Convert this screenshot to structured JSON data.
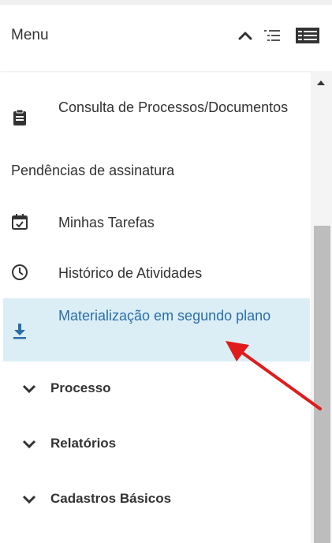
{
  "header": {
    "title": "Menu"
  },
  "menu": {
    "items": [
      {
        "label": "Consulta de Processos/Documentos",
        "icon": "clipboard-icon"
      },
      {
        "label": "Pendências de assinatura"
      },
      {
        "label": "Minhas Tarefas",
        "icon": "calendar-check-icon"
      },
      {
        "label": "Histórico de Atividades",
        "icon": "clock-icon"
      },
      {
        "label": "Materialização em segundo plano",
        "icon": "download-icon",
        "selected": true
      }
    ],
    "groups": [
      {
        "label": "Processo",
        "icon": "chevron-down-icon"
      },
      {
        "label": "Relatórios",
        "icon": "chevron-down-icon"
      },
      {
        "label": "Cadastros Básicos",
        "icon": "chevron-down-icon"
      }
    ]
  },
  "colors": {
    "selected_bg": "#dbeef6",
    "selected_text": "#2b6ea8",
    "annotation_arrow": "#e01b1b"
  }
}
